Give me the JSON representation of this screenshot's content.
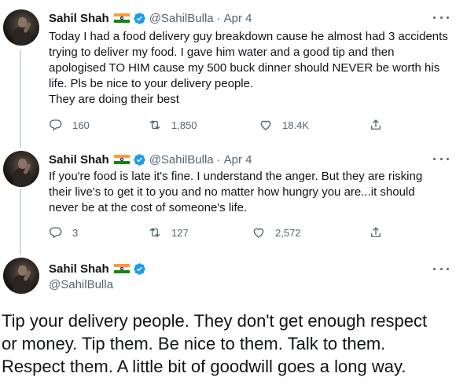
{
  "colors": {
    "text": "#0f1419",
    "muted": "#536471",
    "verified": "#1d9bf0",
    "thread_line": "#cfd9de"
  },
  "tweets": [
    {
      "name": "Sahil Shah",
      "handle": "@SahilBulla",
      "dot": "·",
      "date": "Apr 4",
      "lines": [
        "Today I had a food delivery guy breakdown cause he almost had 3 accidents",
        "trying to deliver my food. I gave him water and a good tip and then",
        "apologised TO HIM cause my 500 buck dinner should NEVER be worth his",
        "life. Pls be nice to your delivery people.",
        "They are doing their best"
      ],
      "replies": "160",
      "retweets": "1,850",
      "likes": "18.4K"
    },
    {
      "name": "Sahil Shah",
      "handle": "@SahilBulla",
      "dot": "·",
      "date": "Apr 4",
      "lines": [
        "If you're food is late it's fine. I understand the anger. But they are risking",
        "their live's to get it to you and no matter how hungry you are...it should",
        "never be at the cost of someone's life."
      ],
      "replies": "3",
      "retweets": "127",
      "likes": "2,572"
    }
  ],
  "main_tweet": {
    "name": "Sahil Shah",
    "handle": "@SahilBulla",
    "lines": [
      "Tip your delivery people. They don't get enough respect",
      "or money. Tip them. Be nice to them. Talk to them.",
      "Respect them. A little bit of goodwill goes a long way."
    ]
  },
  "icons": {
    "verified": "verified-badge-icon",
    "flag": "india-flag-icon",
    "more": "more-options-icon",
    "reply": "reply-icon",
    "retweet": "retweet-icon",
    "like": "heart-icon",
    "share": "share-icon"
  }
}
